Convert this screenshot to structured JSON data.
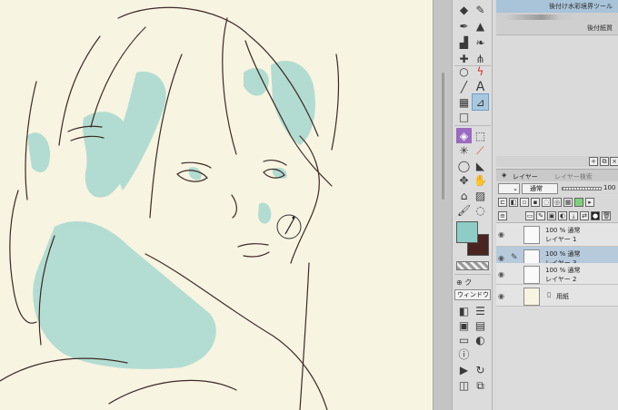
{
  "brush_panel": {
    "items": [
      {
        "label": "後付け水彩境界ツール",
        "selected": true
      },
      {
        "label": "後付紙質",
        "selected": false
      }
    ]
  },
  "layer_panel": {
    "tabs": [
      {
        "label": "レイヤー",
        "active": true
      },
      {
        "label": "レイヤー検索",
        "active": false
      }
    ],
    "blend_mode": "通常",
    "opacity": "100",
    "layers": [
      {
        "line1": "100 % 通常",
        "line2": "レイヤー 1",
        "selected": false
      },
      {
        "line1": "100 % 通常",
        "line2": "レイヤー 3",
        "selected": true
      },
      {
        "line1": "100 % 通常",
        "line2": "レイヤー 2",
        "selected": false
      },
      {
        "line1": "",
        "line2": "用紙",
        "selected": false
      }
    ]
  },
  "toolbar": {
    "window_select": "ウィンドウ",
    "navigator_label": "ク",
    "text_tool_glyph": "A"
  },
  "colors": {
    "main_color": "#8ecdc6",
    "sub_color": "#4a2420",
    "canvas_bg": "#f7f4e1",
    "ink": "#3b2a26",
    "wash": "#a7d8cf",
    "selection": "#a9c8e0"
  }
}
